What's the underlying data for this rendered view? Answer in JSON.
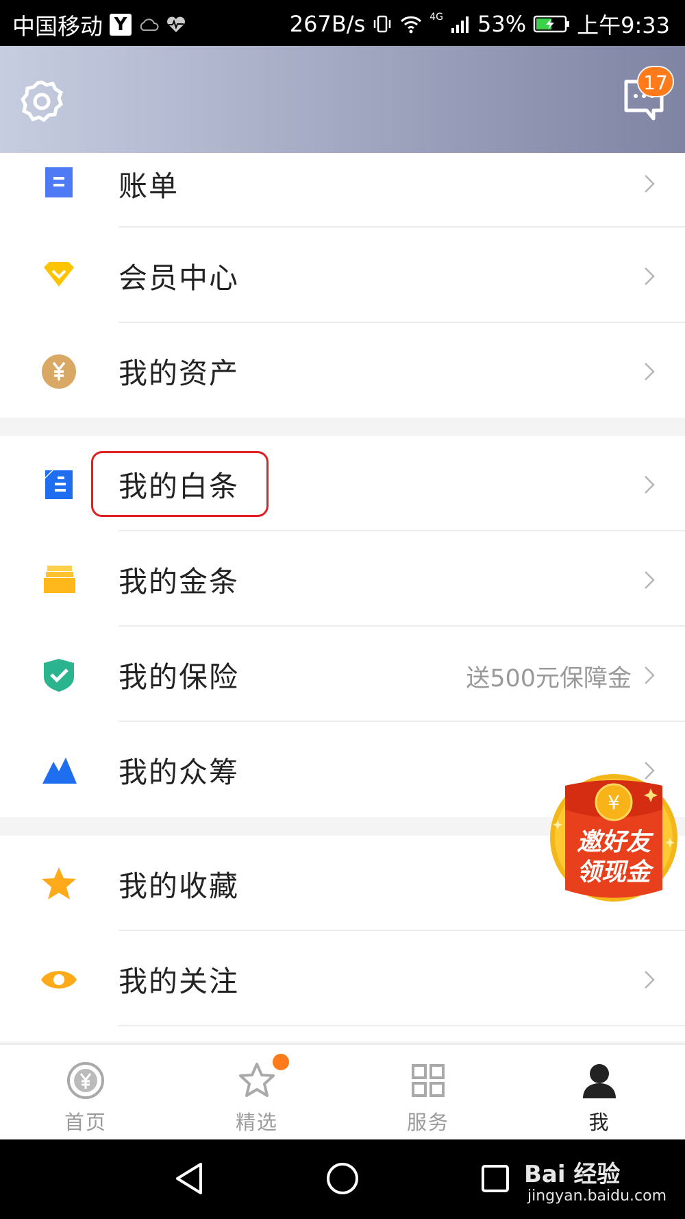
{
  "status_bar": {
    "carrier": "中国移动",
    "app_badge": "Y",
    "speed": "267B/s",
    "network": "4G",
    "battery": "53%",
    "time": "上午9:33"
  },
  "header": {
    "settings_icon": "gear-icon",
    "message_icon": "chat-bubble-icon",
    "message_count": "17"
  },
  "groups": [
    {
      "items": [
        {
          "label": "账单",
          "icon": "bill-icon",
          "color": "#4e7bf5"
        },
        {
          "label": "会员中心",
          "icon": "diamond-icon",
          "color": "#ffc400"
        },
        {
          "label": "我的资产",
          "icon": "yen-coin-icon",
          "color": "#d9a865"
        }
      ]
    },
    {
      "items": [
        {
          "label": "我的白条",
          "icon": "iou-icon",
          "color": "#1f6ef0",
          "highlighted": true
        },
        {
          "label": "我的金条",
          "icon": "gold-bars-icon",
          "color": "#ffb81c"
        },
        {
          "label": "我的保险",
          "icon": "shield-check-icon",
          "color": "#2bb58f",
          "extra": "送500元保障金"
        },
        {
          "label": "我的众筹",
          "icon": "mountain-icon",
          "color": "#1f6ef0"
        }
      ]
    },
    {
      "items": [
        {
          "label": "我的收藏",
          "icon": "star-icon",
          "color": "#ffaa1a"
        },
        {
          "label": "我的关注",
          "icon": "eye-icon",
          "color": "#ffaa1a"
        }
      ]
    }
  ],
  "promo": {
    "line1": "邀好友",
    "line2": "领现金",
    "coin": "¥"
  },
  "tabs": [
    {
      "label": "首页",
      "icon": "yen-circle-icon"
    },
    {
      "label": "精选",
      "icon": "star-outline-icon",
      "dot": true
    },
    {
      "label": "服务",
      "icon": "grid-icon"
    },
    {
      "label": "我",
      "icon": "person-icon",
      "active": true
    }
  ],
  "watermark": {
    "brand": "Bai 经验",
    "url": "jingyan.baidu.com"
  }
}
